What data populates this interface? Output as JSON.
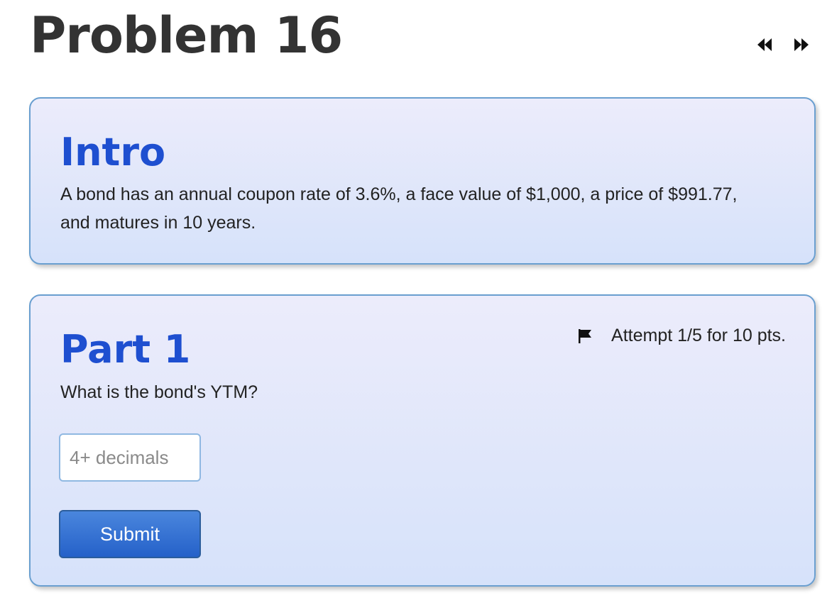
{
  "page": {
    "title": "Problem 16"
  },
  "nav": {
    "prev_icon": "double-chevron-left-icon",
    "next_icon": "double-chevron-right-icon"
  },
  "intro": {
    "heading": "Intro",
    "text": "A bond has an annual coupon rate of 3.6%, a face value of $1,000, a price of $991.77, and matures in 10 years."
  },
  "part1": {
    "heading": "Part 1",
    "question": "What is the bond's YTM?",
    "attempt": "Attempt 1/5 for 10 pts.",
    "flag_icon": "flag-icon",
    "input": {
      "value": "",
      "placeholder": "4+ decimals"
    },
    "submit_label": "Submit"
  },
  "colors": {
    "heading_blue": "#1e4fd0",
    "card_border": "#6a9fd0",
    "button_blue": "#2561c9"
  }
}
